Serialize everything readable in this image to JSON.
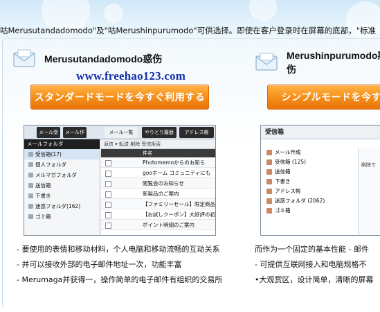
{
  "intro_text": "咕Merusutandadomodo\"及\"咕Merushinpurumodo\"可供选择。即使在客户登录时在屏幕的底部，\"标准",
  "watermark": "www.freehao123.com",
  "colors": {
    "accent": "#f7931e",
    "watermark": "#1530a8"
  },
  "left": {
    "title": "Merusutandadomodo惑伤",
    "cta_label": "スタンダードモードを今すぐ利用する",
    "shot": {
      "tab1": "メール受信",
      "tab2": "メール作成",
      "tab3": "メール一覧",
      "tab4": "やりとり履歴",
      "tab5": "アドレス帳",
      "folder_header": "メールフォルダ",
      "folders": [
        "受信箱(17)",
        "個人フォルダ",
        "メルマガフォルダ",
        "送信箱",
        "下書き",
        "迷惑フォルダ(162)",
        "ゴミ箱"
      ],
      "toolbar": "返信 ▾  転送  削除  受信拒否",
      "column_header": "件名",
      "mails": [
        "Photomemoからのお知ら",
        "gooホーム コミュニティにも",
        "閲覧会のお知らせ",
        "新製品のご案内",
        "【ファミリーセール】限定商品",
        "【お試しクーポン】大好評の初",
        "ポイント明細のご案内"
      ]
    },
    "bullets": [
      "- 要使用的表情和移动材料，个人电脑和移动流畅的互动关系",
      "- 并可以接收外部的电子邮件地址一次，功能丰富",
      "- Merumaga并获得一，操作简单的电子邮件有组织的交易所"
    ]
  },
  "right": {
    "title": "Merushinpurumodo惑伤",
    "cta_label": "シンプルモードを今すぐ",
    "shot": {
      "header": "受信箱",
      "items": [
        "メール作成",
        "受信箱 (125)",
        "送信箱",
        "下書き",
        "アドレス帳",
        "迷惑フォルダ (2062)",
        "ゴミ箱"
      ],
      "side_label": "削除で"
    },
    "bullets": [
      "而作为一个固定的基本性能 - 邮件",
      "- 可提供互联网接入和电脑规格不",
      "•大观赏区，设计简单，清晰的屏幕"
    ]
  }
}
